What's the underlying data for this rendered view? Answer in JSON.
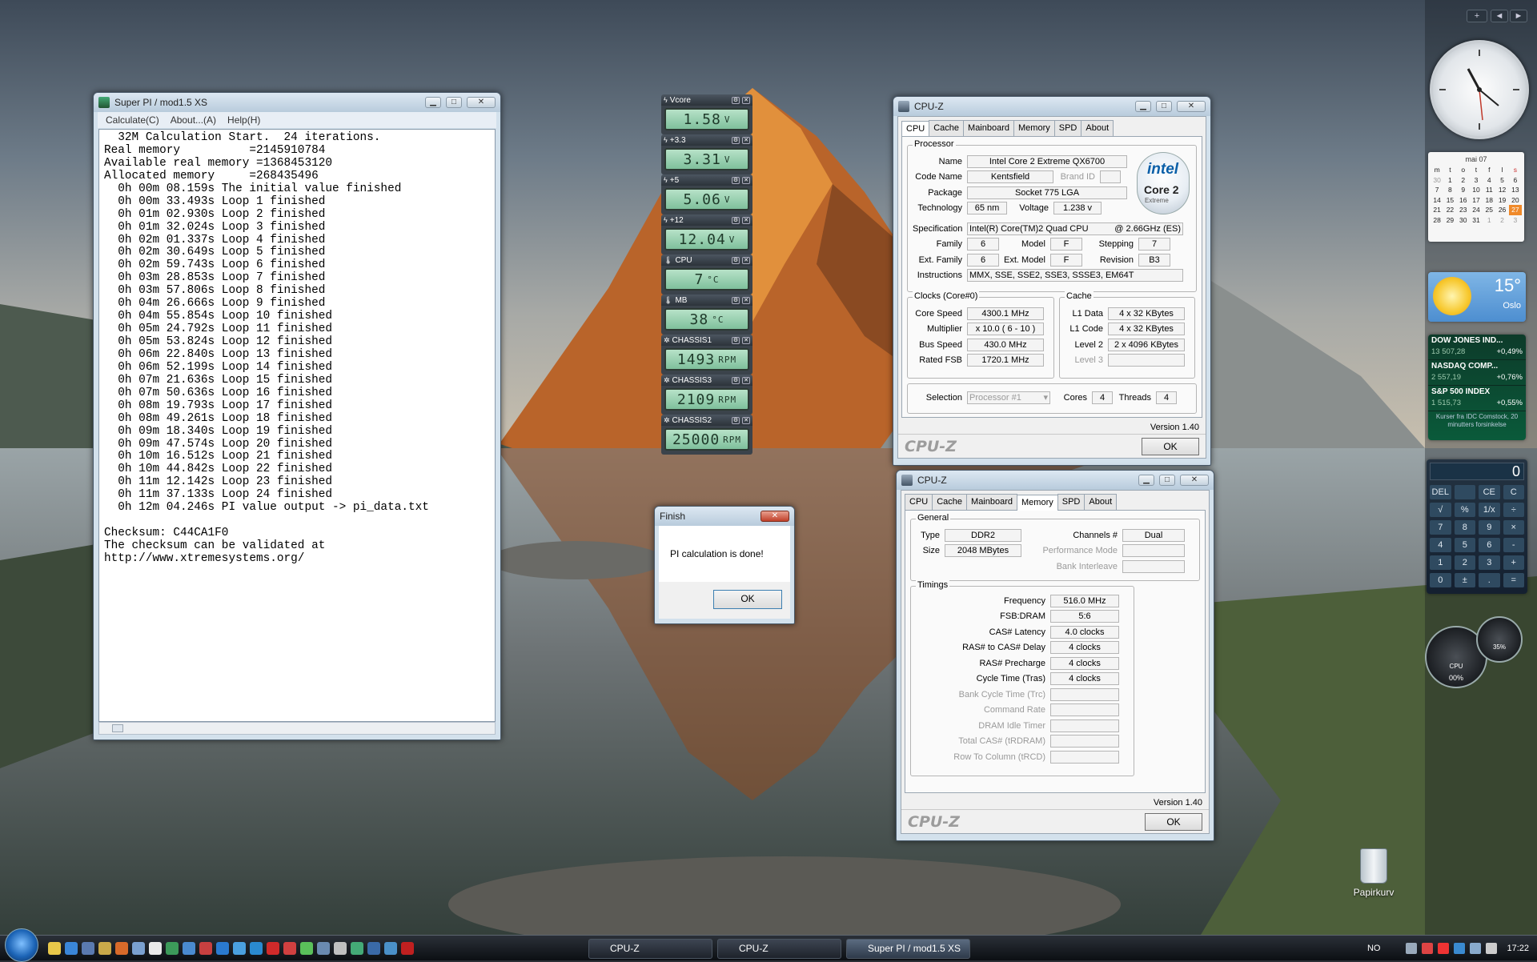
{
  "superpi": {
    "title": "Super PI / mod1.5 XS",
    "menu": [
      "Calculate(C)",
      "About...(A)",
      "Help(H)"
    ],
    "console_lines": [
      "  32M Calculation Start.  24 iterations.",
      "Real memory          =2145910784",
      "Available real memory =1368453120",
      "Allocated memory     =268435496",
      "  0h 00m 08.159s The initial value finished",
      "  0h 00m 33.493s Loop 1 finished",
      "  0h 01m 02.930s Loop 2 finished",
      "  0h 01m 32.024s Loop 3 finished",
      "  0h 02m 01.337s Loop 4 finished",
      "  0h 02m 30.649s Loop 5 finished",
      "  0h 02m 59.743s Loop 6 finished",
      "  0h 03m 28.853s Loop 7 finished",
      "  0h 03m 57.806s Loop 8 finished",
      "  0h 04m 26.666s Loop 9 finished",
      "  0h 04m 55.854s Loop 10 finished",
      "  0h 05m 24.792s Loop 11 finished",
      "  0h 05m 53.824s Loop 12 finished",
      "  0h 06m 22.840s Loop 13 finished",
      "  0h 06m 52.199s Loop 14 finished",
      "  0h 07m 21.636s Loop 15 finished",
      "  0h 07m 50.636s Loop 16 finished",
      "  0h 08m 19.793s Loop 17 finished",
      "  0h 08m 49.261s Loop 18 finished",
      "  0h 09m 18.340s Loop 19 finished",
      "  0h 09m 47.574s Loop 20 finished",
      "  0h 10m 16.512s Loop 21 finished",
      "  0h 10m 44.842s Loop 22 finished",
      "  0h 11m 12.142s Loop 23 finished",
      "  0h 11m 37.133s Loop 24 finished",
      "  0h 12m 04.246s PI value output -> pi_data.txt",
      "",
      "Checksum: C44CA1F0",
      "The checksum can be validated at",
      "http://www.xtremesystems.org/"
    ]
  },
  "sensors": [
    {
      "name": "Vcore",
      "value": "1.58",
      "unit": "V",
      "icon": "bolt-icon"
    },
    {
      "name": "+3.3",
      "value": "3.31",
      "unit": "V",
      "icon": "bolt-icon"
    },
    {
      "name": "+5",
      "value": "5.06",
      "unit": "V",
      "icon": "bolt-icon"
    },
    {
      "name": "+12",
      "value": "12.04",
      "unit": "V",
      "icon": "bolt-icon"
    },
    {
      "name": "CPU",
      "value": "7",
      "unit": "°C",
      "icon": "thermometer-icon"
    },
    {
      "name": "MB",
      "value": "38",
      "unit": "°C",
      "icon": "thermometer-icon"
    },
    {
      "name": "CHASSIS1",
      "value": "1493",
      "unit": "RPM",
      "icon": "fan-icon"
    },
    {
      "name": "CHASSIS3",
      "value": "2109",
      "unit": "RPM",
      "icon": "fan-icon"
    },
    {
      "name": "CHASSIS2",
      "value": "25000",
      "unit": "RPM",
      "icon": "fan-icon"
    }
  ],
  "cpuz_cpu": {
    "title": "CPU-Z",
    "tabs": [
      "CPU",
      "Cache",
      "Mainboard",
      "Memory",
      "SPD",
      "About"
    ],
    "processor_legend": "Processor",
    "name_label": "Name",
    "name": "Intel Core 2 Extreme QX6700",
    "codename_label": "Code Name",
    "codename": "Kentsfield",
    "brandid_label": "Brand ID",
    "brandid": "",
    "package_label": "Package",
    "package": "Socket 775 LGA",
    "technology_label": "Technology",
    "technology": "65 nm",
    "voltage_label": "Voltage",
    "voltage": "1.238 v",
    "spec_label": "Specification",
    "spec": "Intel(R) Core(TM)2 Quad CPU",
    "spec_freq": "@ 2.66GHz (ES)",
    "family_label": "Family",
    "family": "6",
    "model_label": "Model",
    "model": "F",
    "stepping_label": "Stepping",
    "stepping": "7",
    "extfamily_label": "Ext. Family",
    "extfamily": "6",
    "extmodel_label": "Ext. Model",
    "extmodel": "F",
    "revision_label": "Revision",
    "revision": "B3",
    "instructions_label": "Instructions",
    "instructions": "MMX, SSE, SSE2, SSE3, SSSE3, EM64T",
    "clocks_legend": "Clocks (Core#0)",
    "corespeed_label": "Core Speed",
    "corespeed": "4300.1 MHz",
    "multiplier_label": "Multiplier",
    "multiplier": "x 10.0 ( 6 - 10 )",
    "busspeed_label": "Bus Speed",
    "busspeed": "430.0 MHz",
    "ratedfsb_label": "Rated FSB",
    "ratedfsb": "1720.1 MHz",
    "cache_legend": "Cache",
    "l1data_label": "L1 Data",
    "l1data": "4 x 32 KBytes",
    "l1code_label": "L1 Code",
    "l1code": "4 x 32 KBytes",
    "level2_label": "Level 2",
    "level2": "2 x 4096 KBytes",
    "level3_label": "Level 3",
    "level3": "",
    "selection_label": "Selection",
    "selection": "Processor #1",
    "cores_label": "Cores",
    "cores": "4",
    "threads_label": "Threads",
    "threads": "4",
    "version": "Version 1.40",
    "ok": "OK",
    "logo": "CPU-Z",
    "intel_word": "intel",
    "intel_brand": "Core 2",
    "intel_sub": "Extreme"
  },
  "cpuz_mem": {
    "title": "CPU-Z",
    "tabs": [
      "CPU",
      "Cache",
      "Mainboard",
      "Memory",
      "SPD",
      "About"
    ],
    "general_legend": "General",
    "type_label": "Type",
    "type": "DDR2",
    "size_label": "Size",
    "size": "2048 MBytes",
    "channels_label": "Channels #",
    "channels": "Dual",
    "perfmode_label": "Performance Mode",
    "perfmode": "",
    "bankinterleave_label": "Bank Interleave",
    "bankinterleave": "",
    "timings_legend": "Timings",
    "timings": [
      {
        "label": "Frequency",
        "value": "516.0 MHz",
        "dim": false
      },
      {
        "label": "FSB:DRAM",
        "value": "5:6",
        "dim": false
      },
      {
        "label": "CAS# Latency",
        "value": "4.0 clocks",
        "dim": false
      },
      {
        "label": "RAS# to CAS# Delay",
        "value": "4 clocks",
        "dim": false
      },
      {
        "label": "RAS# Precharge",
        "value": "4 clocks",
        "dim": false
      },
      {
        "label": "Cycle Time (Tras)",
        "value": "4 clocks",
        "dim": false
      },
      {
        "label": "Bank Cycle Time (Trc)",
        "value": "",
        "dim": true
      },
      {
        "label": "Command Rate",
        "value": "",
        "dim": true
      },
      {
        "label": "DRAM Idle Timer",
        "value": "",
        "dim": true
      },
      {
        "label": "Total CAS# (tRDRAM)",
        "value": "",
        "dim": true
      },
      {
        "label": "Row To Column (tRCD)",
        "value": "",
        "dim": true
      }
    ],
    "version": "Version 1.40",
    "ok": "OK",
    "logo": "CPU-Z"
  },
  "finish": {
    "title": "Finish",
    "message": "PI calculation is done!",
    "ok": "OK"
  },
  "sidebar": {
    "calendar": {
      "month": "mai 07",
      "days": [
        "m",
        "t",
        "o",
        "t",
        "f",
        "l",
        "s"
      ],
      "weeks": [
        [
          "30",
          "1",
          "2",
          "3",
          "4",
          "5",
          "6"
        ],
        [
          "7",
          "8",
          "9",
          "10",
          "11",
          "12",
          "13"
        ],
        [
          "14",
          "15",
          "16",
          "17",
          "18",
          "19",
          "20"
        ],
        [
          "21",
          "22",
          "23",
          "24",
          "25",
          "26",
          "27"
        ],
        [
          "28",
          "29",
          "30",
          "31",
          "1",
          "2",
          "3"
        ]
      ]
    },
    "weather": {
      "temp": "15°",
      "city": "Oslo"
    },
    "stocks": [
      {
        "name": "DOW JONES IND...",
        "value": "13 507,28",
        "change": "+0,49%"
      },
      {
        "name": "NASDAQ COMP...",
        "value": "2 557,19",
        "change": "+0,76%"
      },
      {
        "name": "S&P 500 INDEX",
        "value": "1 515,73",
        "change": "+0,55%"
      }
    ],
    "stocks_note": "Kurser fra IDC Comstock, 20 minutters forsinkelse",
    "calculator": {
      "display": "0",
      "keys": [
        "DEL",
        "",
        "CE",
        "C",
        "√",
        "%",
        "1/x",
        "÷",
        "7",
        "8",
        "9",
        "×",
        "4",
        "5",
        "6",
        "-",
        "1",
        "2",
        "3",
        "+",
        "0",
        "±",
        ".",
        "="
      ]
    },
    "meter_cpu": "00%",
    "meter_mem": "35%",
    "meter_cpu_label": "CPU",
    "add_button": "+",
    "nav_prev": "◄",
    "nav_next": "►"
  },
  "desktop": {
    "recycle_bin": "Papirkurv"
  },
  "taskbar": {
    "buttons": [
      "CPU-Z",
      "CPU-Z",
      "Super PI / mod1.5 XS"
    ],
    "lang": "NO",
    "time": "17:22"
  }
}
